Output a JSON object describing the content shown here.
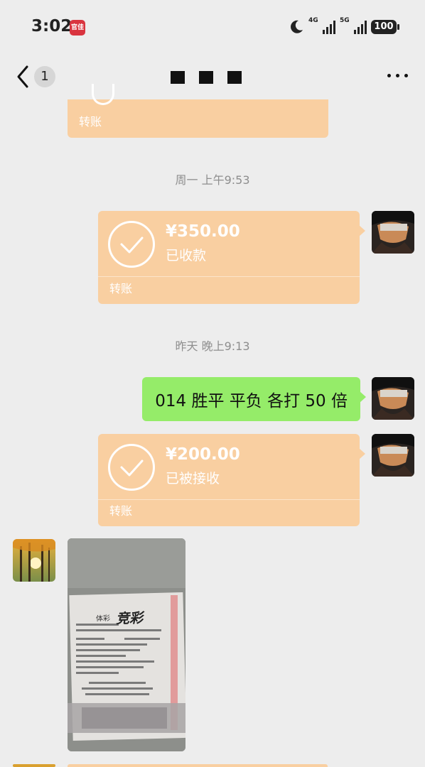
{
  "status_bar": {
    "time": "3:02",
    "app_badge": "官佳",
    "network1": "4G",
    "network2": "5G",
    "battery": "100"
  },
  "nav": {
    "unread_count": "1",
    "icons": {
      "back": "chevron-left-icon",
      "more": "more-dots-icon"
    }
  },
  "messages": {
    "top_transfer_kind": "转账",
    "timestamp1": "周一 上午9:53",
    "transfer1": {
      "amount": "¥350.00",
      "status": "已收款",
      "kind": "转账"
    },
    "timestamp2": "昨天 晚上9:13",
    "text1": "014 胜平 平负 各打 50 倍",
    "transfer2": {
      "amount": "¥200.00",
      "status": "已被接收",
      "kind": "转账"
    },
    "photo_ticket": {
      "brand_small": "体彩",
      "brand_large": "竞彩"
    }
  },
  "colors": {
    "background": "#ededed",
    "transfer_bubble": "#f9cfa1",
    "text_bubble": "#95ec69"
  }
}
